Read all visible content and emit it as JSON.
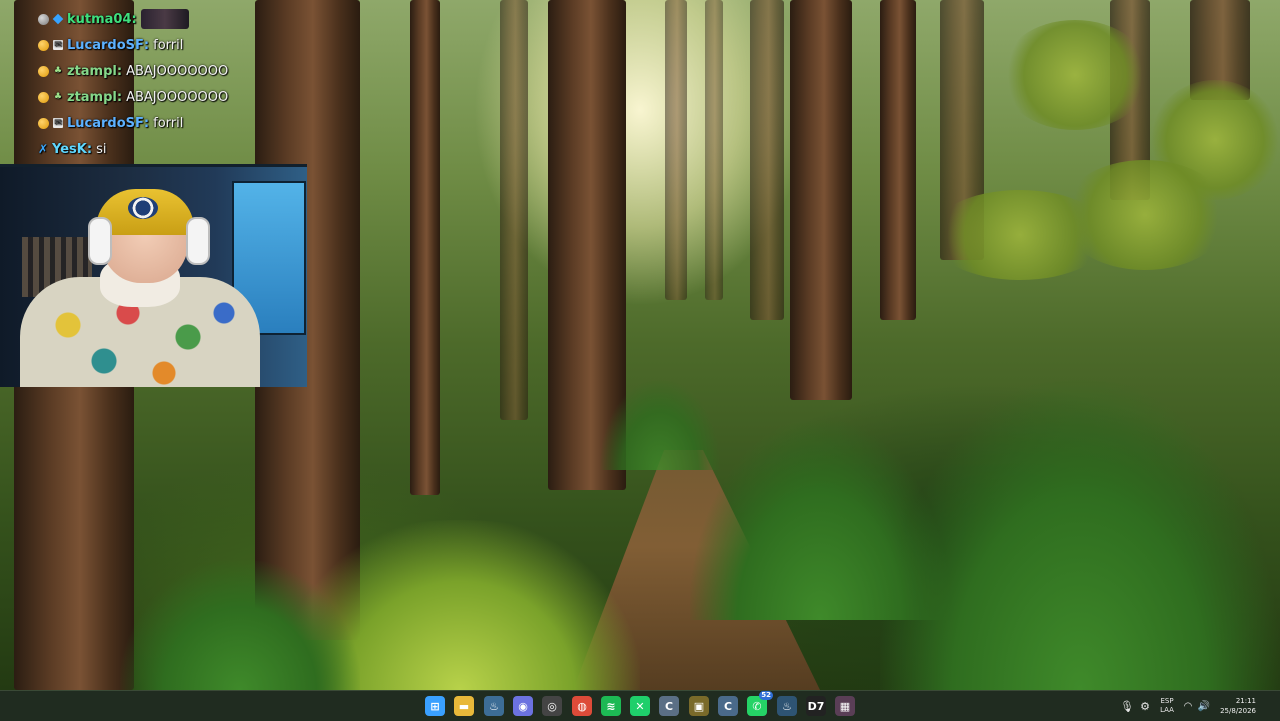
{
  "chat": {
    "messages": [
      {
        "badge": "grey-dot",
        "user": "kutma04",
        "user_color": "#3fdf7d",
        "text": "",
        "has_emote": true
      },
      {
        "badge": "sub",
        "user": "LucardoSF",
        "user_color": "#5db1ff",
        "text": "forril"
      },
      {
        "badge": "sub",
        "user": "ztampl",
        "user_color": "#86d88a",
        "text": "ABAJOOOOOOO"
      },
      {
        "badge": "sub",
        "user": "ztampl",
        "user_color": "#86d88a",
        "text": "ABAJOOOOOOO"
      },
      {
        "badge": "sub",
        "user": "LucardoSF",
        "user_color": "#5db1ff",
        "text": "forril"
      },
      {
        "badge": "x",
        "user": "YesK",
        "user_color": "#5fd7ff",
        "text": "si"
      }
    ]
  },
  "webcam": {
    "label": "webcam-feed"
  },
  "taskbar": {
    "icons": [
      {
        "name": "windows-start-icon",
        "glyph": "⊞",
        "color": "#3aa0ff"
      },
      {
        "name": "file-explorer-icon",
        "glyph": "▬",
        "color": "#e8b83a"
      },
      {
        "name": "steam-icon",
        "glyph": "♨",
        "color": "#3d6d96"
      },
      {
        "name": "discord-icon",
        "glyph": "◉",
        "color": "#6c72e0"
      },
      {
        "name": "obs-icon",
        "glyph": "◎",
        "color": "#444444"
      },
      {
        "name": "chrome-icon",
        "glyph": "◍",
        "color": "#dd4b39"
      },
      {
        "name": "spotify-icon",
        "glyph": "≋",
        "color": "#1db954"
      },
      {
        "name": "capcut-icon",
        "glyph": "✕",
        "color": "#1fcf6b"
      },
      {
        "name": "ccleaner-icon",
        "glyph": "C",
        "color": "#5b6f85"
      },
      {
        "name": "game-launcher-icon",
        "glyph": "▣",
        "color": "#7a6a2a"
      },
      {
        "name": "ccleaner-alt-icon",
        "glyph": "C",
        "color": "#4a6a8a"
      },
      {
        "name": "whatsapp-icon",
        "glyph": "✆",
        "color": "#25d366",
        "badge": "52"
      },
      {
        "name": "steam-alt-icon",
        "glyph": "♨",
        "color": "#2e5473"
      },
      {
        "name": "deeper-icon",
        "glyph": "D7",
        "color": "#222222"
      },
      {
        "name": "app-icon",
        "glyph": "▦",
        "color": "#5a3e56"
      }
    ],
    "tray": {
      "language_line1": "ESP",
      "language_line2": "LAA",
      "time": "21:11",
      "date": "25/8/2026"
    }
  }
}
